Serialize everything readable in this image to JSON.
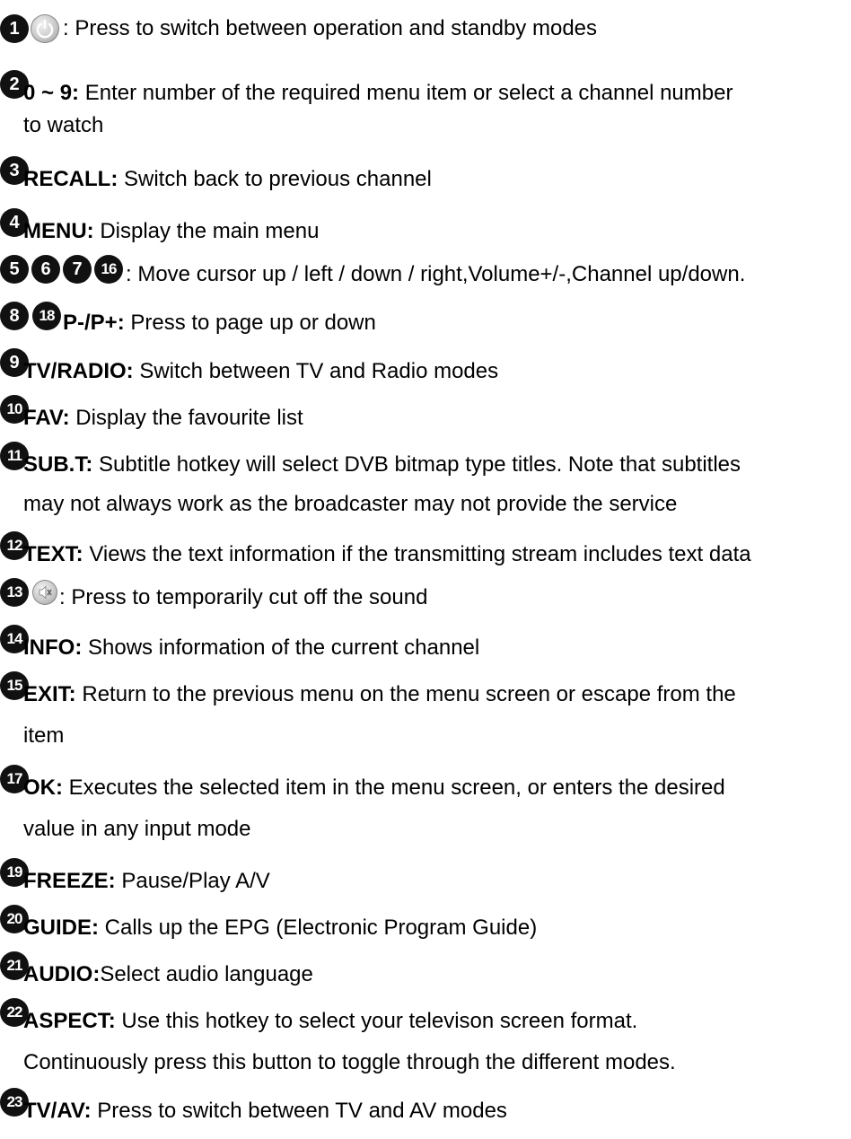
{
  "items": [
    {
      "num": "1",
      "key": "",
      "desc": " : Press to switch between operation and standby modes",
      "icon": "power-icon"
    },
    {
      "num": "2",
      "key": "0 ~ 9:",
      "desc": " Enter number of the required menu item or select a channel number",
      "cont": "to watch"
    },
    {
      "num": "3",
      "key": "RECALL:",
      "desc": " Switch back to previous channel"
    },
    {
      "num": "4",
      "key": "MENU:",
      "desc": " Display the main menu"
    },
    {
      "nums": [
        "5",
        "6",
        "7",
        "16"
      ],
      "key": "",
      "desc": ": Move cursor up / left / down / right,Volume+/-,Channel up/down."
    },
    {
      "nums": [
        "8",
        "18"
      ],
      "key": "P-/P+:",
      "desc": " Press to page up or down"
    },
    {
      "num": "9",
      "key": "TV/RADIO:",
      "desc": " Switch between TV and Radio modes"
    },
    {
      "num": "10",
      "key": "FAV:",
      "desc": " Display the favourite list"
    },
    {
      "num": "11",
      "key": "SUB.T:",
      "desc": " Subtitle hotkey will select DVB bitmap type titles. Note that subtitles",
      "cont": "may not always work as the broadcaster may not provide the service"
    },
    {
      "num": "12",
      "key": "TEXT:",
      "desc": " Views the text information if the transmitting stream includes text data"
    },
    {
      "num": "13",
      "key": "",
      "desc": ": Press to temporarily cut off the sound",
      "icon": "mute-icon"
    },
    {
      "num": "14",
      "key": "INFO:",
      "desc": " Shows information of the current channel"
    },
    {
      "num": "15",
      "key": "EXIT:",
      "desc": " Return to the previous menu on the menu screen or escape from the",
      "cont": "item"
    },
    {
      "num": "17",
      "key": "OK:",
      "desc": " Executes the selected item in the menu screen, or enters the desired",
      "cont": "value in any input mode"
    },
    {
      "num": "19",
      "key": "FREEZE:",
      "desc": " Pause/Play A/V"
    },
    {
      "num": "20",
      "key": "GUIDE:",
      "desc": " Calls up the EPG (Electronic Program Guide)"
    },
    {
      "num": "21",
      "key": "AUDIO:",
      "desc": "Select audio language"
    },
    {
      "num": "22",
      "key": "ASPECT:",
      "desc": " Use this hotkey to select your televison screen format.",
      "cont": "Continuously press this button to toggle through the different modes."
    },
    {
      "num": "23",
      "key": "TV/AV:",
      "desc": " Press to switch between TV and AV modes"
    }
  ]
}
